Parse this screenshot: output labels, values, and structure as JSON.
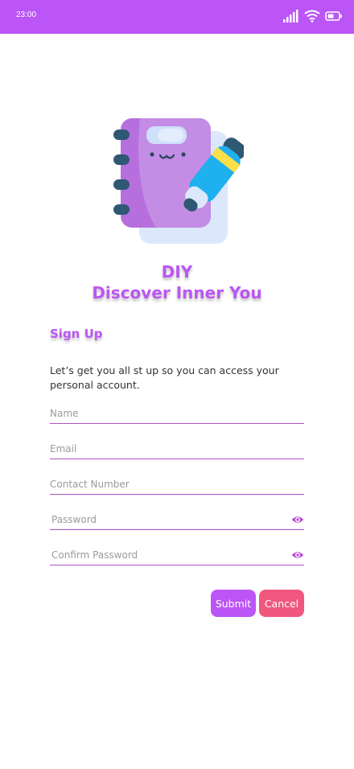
{
  "status_bar": {
    "time": "23:00",
    "background": "#bb55f5",
    "icons": [
      "signal-icon",
      "wifi-icon",
      "battery-icon"
    ]
  },
  "app": {
    "title_line1": "DIY",
    "title_line2": "Discover Inner You",
    "accent": "#bb55f5",
    "illustration": "notebook-with-pen-icon"
  },
  "signup": {
    "heading": "Sign Up",
    "description": "Let’s get you all st up so you can access your personal account."
  },
  "form": {
    "name": {
      "placeholder": "Name",
      "value": ""
    },
    "email": {
      "placeholder": "Email",
      "value": ""
    },
    "contact": {
      "placeholder": "Contact Number",
      "value": ""
    },
    "password": {
      "placeholder": "Password",
      "value": "",
      "icon": "eye-icon"
    },
    "confirm_password": {
      "placeholder": "Confirm Password",
      "value": "",
      "icon": "eye-icon"
    }
  },
  "actions": {
    "submit_label": "Submit",
    "cancel_label": "Cancel",
    "submit_color": "#bb55f5",
    "cancel_color": "#f0577e"
  }
}
